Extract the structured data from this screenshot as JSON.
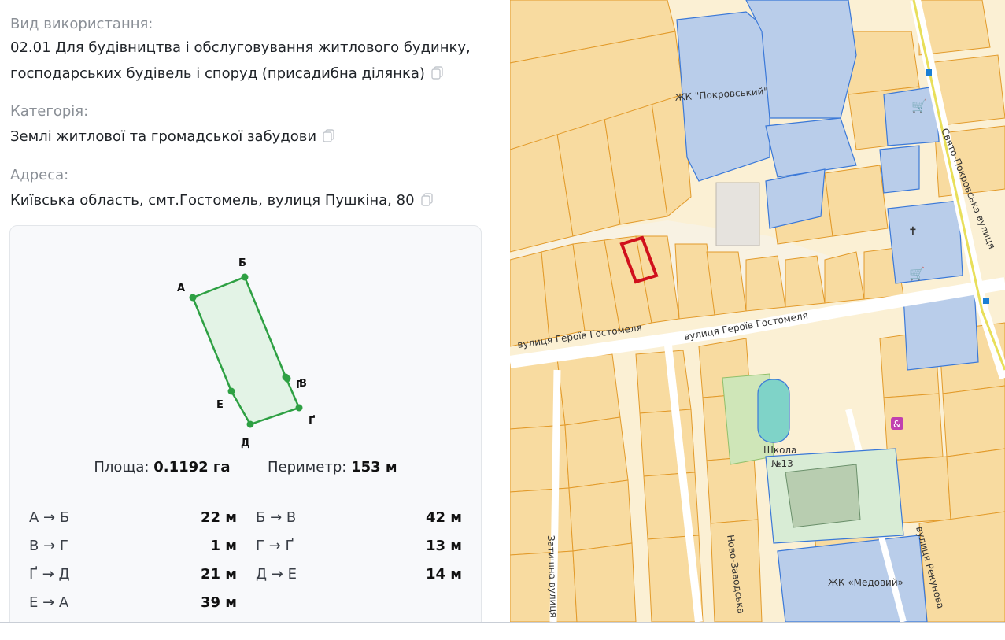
{
  "usage": {
    "label": "Вид використання:",
    "value_line1": "02.01 Для будівництва і обслуговування житлового будинку,",
    "value_line2": "господарських будівель і споруд (присадибна ділянка)"
  },
  "category": {
    "label": "Категорія:",
    "value": "Землі житлової та громадської забудови"
  },
  "address": {
    "label": "Адреса:",
    "value": "Київська область, смт.Гостомель, вулиця Пушкіна, 80"
  },
  "parcel": {
    "points": [
      "А",
      "Б",
      "В",
      "Г",
      "Ґ",
      "Д",
      "Е"
    ],
    "area_label": "Площа:",
    "area_value": "0.1192 га",
    "perimeter_label": "Периметр:",
    "perimeter_value": "153 м",
    "segments": [
      {
        "name": "А → Б",
        "length": "22 м"
      },
      {
        "name": "Б → В",
        "length": "42 м"
      },
      {
        "name": "В → Г",
        "length": "1 м"
      },
      {
        "name": "Г → Ґ",
        "length": "13 м"
      },
      {
        "name": "Ґ → Д",
        "length": "21 м"
      },
      {
        "name": "Д → Е",
        "length": "14 м"
      },
      {
        "name": "Е → А",
        "length": "39 м"
      }
    ]
  },
  "map": {
    "labels": {
      "complex_north": "ЖК \"Покровський\"",
      "street_main_left": "вулиця Героїв Гостомеля",
      "street_main_center": "вулиця Героїв Гостомеля",
      "street_right": "Свято-Покровська вулиця",
      "school": "Школа",
      "school_num": "№13",
      "complex_south": "ЖК «Медовий»",
      "street_bottom_left": "Затишна вулиця",
      "street_bottom_center": "Ново-Заводська",
      "street_bottom_right": "вулиця Рекунова"
    },
    "colors": {
      "parcel_fill": "#f7d79a",
      "parcel_stroke": "#e29a2a",
      "blue_fill": "#b9cdea",
      "blue_stroke": "#3a78d8",
      "selected": "#d0101c",
      "road": "#ffffff",
      "green": "#cfe6b8",
      "pool": "#7fd3c8"
    }
  },
  "theme": {
    "accent_green": "#2ea043",
    "polygon_fill": "#e3f3e6"
  }
}
